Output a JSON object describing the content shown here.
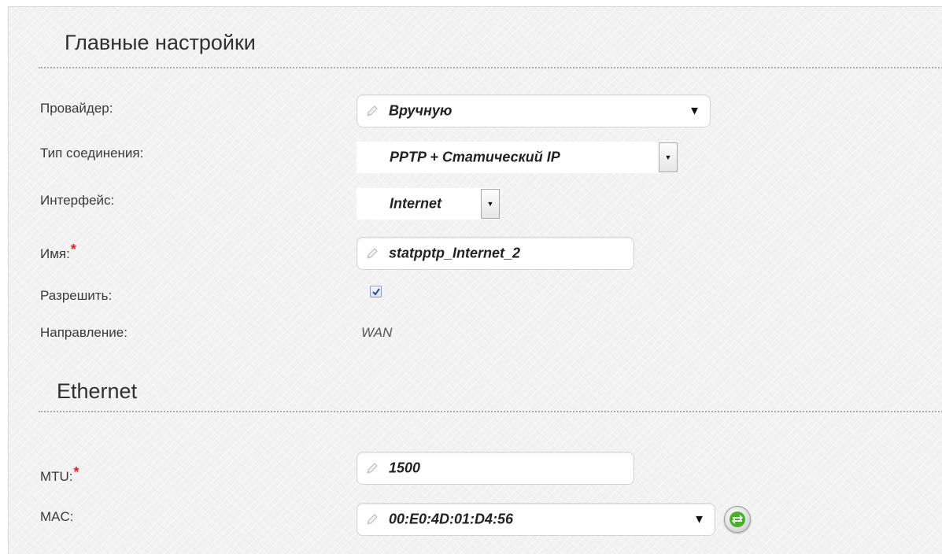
{
  "sections": {
    "main_title": "Главные настройки",
    "ethernet_title": "Ethernet"
  },
  "labels": {
    "provider": "Провайдер:",
    "connection_type": "Тип соединения:",
    "interface": "Интерфейс:",
    "name": "Имя:",
    "enable": "Разрешить:",
    "direction": "Направление:",
    "mtu": "MTU:",
    "mac": "MAC:",
    "required_mark": "*"
  },
  "values": {
    "provider": "Вручную",
    "connection_type": "PPTP + Статический IP",
    "interface": "Internet",
    "name": "statpptp_Internet_2",
    "enable_checked": true,
    "direction": "WAN",
    "mtu": "1500",
    "mac": "00:E0:4D:01:D4:56"
  },
  "icons": {
    "dropdown_arrow": "▼",
    "small_arrow": "▼",
    "edit": "pencil-icon",
    "refresh": "refresh-arrows-icon"
  },
  "colors": {
    "required": "#e0232b",
    "refresh_green": "#4caf2a"
  }
}
